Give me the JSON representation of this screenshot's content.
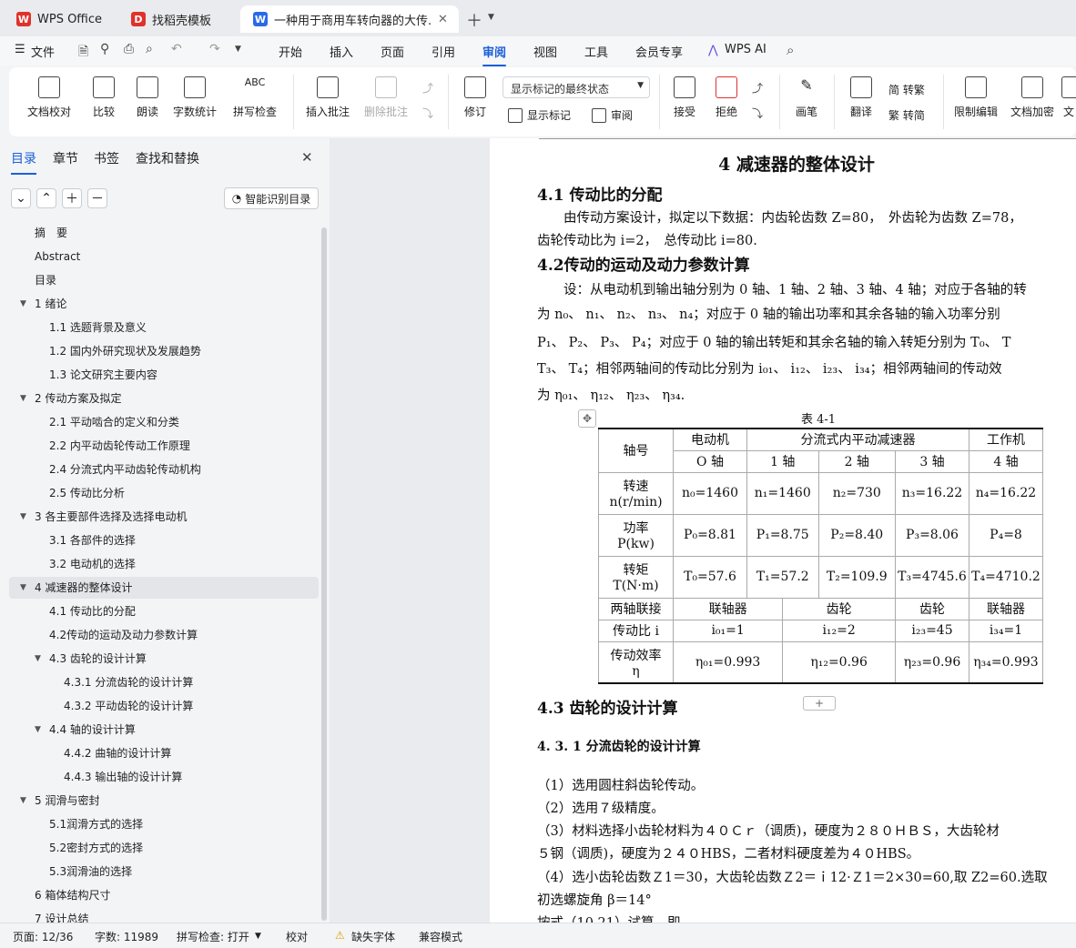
{
  "tabs": [
    {
      "label": "WPS Office"
    },
    {
      "label": "找稻壳模板"
    },
    {
      "label": "一种用于商用车转向器的大传..."
    }
  ],
  "menu": {
    "file": "文件",
    "items": [
      "开始",
      "插入",
      "页面",
      "引用",
      "审阅",
      "视图",
      "工具",
      "会员专享"
    ],
    "ai": "WPS AI"
  },
  "ribbon": {
    "doc_check": "文档校对",
    "compare": "比较",
    "read": "朗读",
    "word_count": "字数统计",
    "spell": "拼写检查",
    "insert_comment": "插入批注",
    "delete_comment": "删除批注",
    "markup_select": "显示标记的最终状态",
    "revise": "修订",
    "show_markup": "显示标记",
    "review": "审阅",
    "accept": "接受",
    "reject": "拒绝",
    "pen": "画笔",
    "translate": "翻译",
    "to_trad": "简 转繁",
    "to_simp": "繁 转简",
    "restrict": "限制编辑",
    "encrypt": "文档加密",
    "more": "文"
  },
  "panel": {
    "tabs": [
      "目录",
      "章节",
      "书签",
      "查找和替换"
    ],
    "smart_toc": "智能识别目录"
  },
  "toc": [
    {
      "label": "摘　要",
      "level": 0
    },
    {
      "label": "Abstract",
      "level": 0
    },
    {
      "label": "目录",
      "level": 0
    },
    {
      "label": "1  绪论",
      "level": 0,
      "arrow": true
    },
    {
      "label": "1.1  选题背景及意义",
      "level": 1
    },
    {
      "label": "1.2  国内外研究现状及发展趋势",
      "level": 1
    },
    {
      "label": "1.3  论文研究主要内容",
      "level": 1
    },
    {
      "label": "2  传动方案及拟定",
      "level": 0,
      "arrow": true
    },
    {
      "label": "2.1  平动啮合的定义和分类",
      "level": 1
    },
    {
      "label": "2.2  内平动齿轮传动工作原理",
      "level": 1
    },
    {
      "label": "2.4  分流式内平动齿轮传动机构",
      "level": 1
    },
    {
      "label": "2.5  传动比分析",
      "level": 1
    },
    {
      "label": "3  各主要部件选择及选择电动机",
      "level": 0,
      "arrow": true
    },
    {
      "label": "3.1  各部件的选择",
      "level": 1
    },
    {
      "label": "3.2  电动机的选择",
      "level": 1
    },
    {
      "label": "4  减速器的整体设计",
      "level": 0,
      "arrow": true,
      "selected": true
    },
    {
      "label": "4.1  传动比的分配",
      "level": 1
    },
    {
      "label": "4.2传动的运动及动力参数计算",
      "level": 1
    },
    {
      "label": "4.3  齿轮的设计计算",
      "level": 1,
      "arrow": true
    },
    {
      "label": "4.3.1  分流齿轮的设计计算",
      "level": 2
    },
    {
      "label": "4.3.2  平动齿轮的设计计算",
      "level": 2
    },
    {
      "label": "4.4  轴的设计计算",
      "level": 1,
      "arrow": true
    },
    {
      "label": "4.4.2  曲轴的设计计算",
      "level": 2
    },
    {
      "label": "4.4.3  输出轴的设计计算",
      "level": 2
    },
    {
      "label": "5  润滑与密封",
      "level": 0,
      "arrow": true
    },
    {
      "label": "5.1润滑方式的选择",
      "level": 1
    },
    {
      "label": "5.2密封方式的选择",
      "level": 1
    },
    {
      "label": "5.3润滑油的选择",
      "level": 1
    },
    {
      "label": "6  箱体结构尺寸",
      "level": 0
    },
    {
      "label": "7  设计总结",
      "level": 0
    }
  ],
  "doc": {
    "h1": "4  减速器的整体设计",
    "s41": "4.1  传动比的分配",
    "p1": "　　由传动方案设计，拟定以下数据：内齿轮齿数 Z=80，　外齿轮为齿数 Z=78，",
    "p2": "齿轮传动比为 i=2，　总传动比 i=80.",
    "s42": "4.2传动的运动及动力参数计算",
    "p3": "　　设：从电动机到输出轴分别为 0 轴、1 轴、2 轴、3 轴、4 轴；对应于各轴的转",
    "p4": "为  n₀、 n₁、 n₂、 n₃、 n₄；对应于 0 轴的输出功率和其余各轴的输入功率分别",
    "p5": "P₁、 P₂、 P₃、 P₄；对应于 0 轴的输出转矩和其余名轴的输入转矩分别为  T₀、 T",
    "p6": "T₃、 T₄；相邻两轴间的传动比分别为  i₀₁、 i₁₂、 i₂₃、 i₃₄；相邻两轴间的传动效",
    "p7": "为  η₀₁、 η₁₂、 η₂₃、 η₃₄.",
    "caption": "表 4-1",
    "s43": "4.3  齿轮的设计计算",
    "s431": "4. 3. 1  分流齿轮的设计计算",
    "l1": "（1）选用圆柱斜齿轮传动。",
    "l2": "（2）选用７级精度。",
    "l3": "（3）材料选择小齿轮材料为４０Ｃｒ（调质)，硬度为２８０ＨＢＳ，大齿轮材",
    "l4": "５钢（调质)，硬度为２４０HBS，二者材料硬度差为４０HBS。",
    "l5": "（4）选小齿轮齿数Ｚ1＝30，大齿轮齿数Ｚ2＝ｉ12·Ｚ1＝2×30=60,取 Z2=60.选取",
    "l6": "初选螺旋角 β＝14°",
    "l7": "按式（10.21）试算，即"
  },
  "table": {
    "h_axis": "轴号",
    "h_motor": "电动机",
    "h_reducer": "分流式内平动减速器",
    "h_worker": "工作机",
    "axes": [
      "O 轴",
      "1 轴",
      "2 轴",
      "3 轴",
      "4 轴"
    ],
    "speed_label1": "转速",
    "speed_label2": "n(r/min)",
    "speed": [
      "n₀=1460",
      "n₁=1460",
      "n₂=730",
      "n₃=16.22",
      "n₄=16.22"
    ],
    "power_label1": "功率",
    "power_label2": "P(kw)",
    "power": [
      "P₀=8.81",
      "P₁=8.75",
      "P₂=8.40",
      "P₃=8.06",
      "P₄=8"
    ],
    "torque_label1": "转矩",
    "torque_label2": "T(N·m)",
    "torque": [
      "T₀=57.6",
      "T₁=57.2",
      "T₂=109.9",
      "T₃=4745.6",
      "T₄=4710.2"
    ],
    "coupling_label": "两轴联接",
    "coupling": [
      "联轴器",
      "齿轮",
      "齿轮",
      "联轴器"
    ],
    "ratio_label": "传动比 i",
    "ratio": [
      "i₀₁=1",
      "i₁₂=2",
      "i₂₃=45",
      "i₃₄=1"
    ],
    "eff_label1": "传动效率",
    "eff_label2": "η",
    "eff": [
      "η₀₁=0.993",
      "η₁₂=0.96",
      "η₂₃=0.96",
      "η₃₄=0.993"
    ]
  },
  "status": {
    "page": "页面: 12/36",
    "words": "字数: 11989",
    "spell": "拼写检查: 打开",
    "proof": "校对",
    "font": "缺失字体",
    "compat": "兼容模式"
  }
}
